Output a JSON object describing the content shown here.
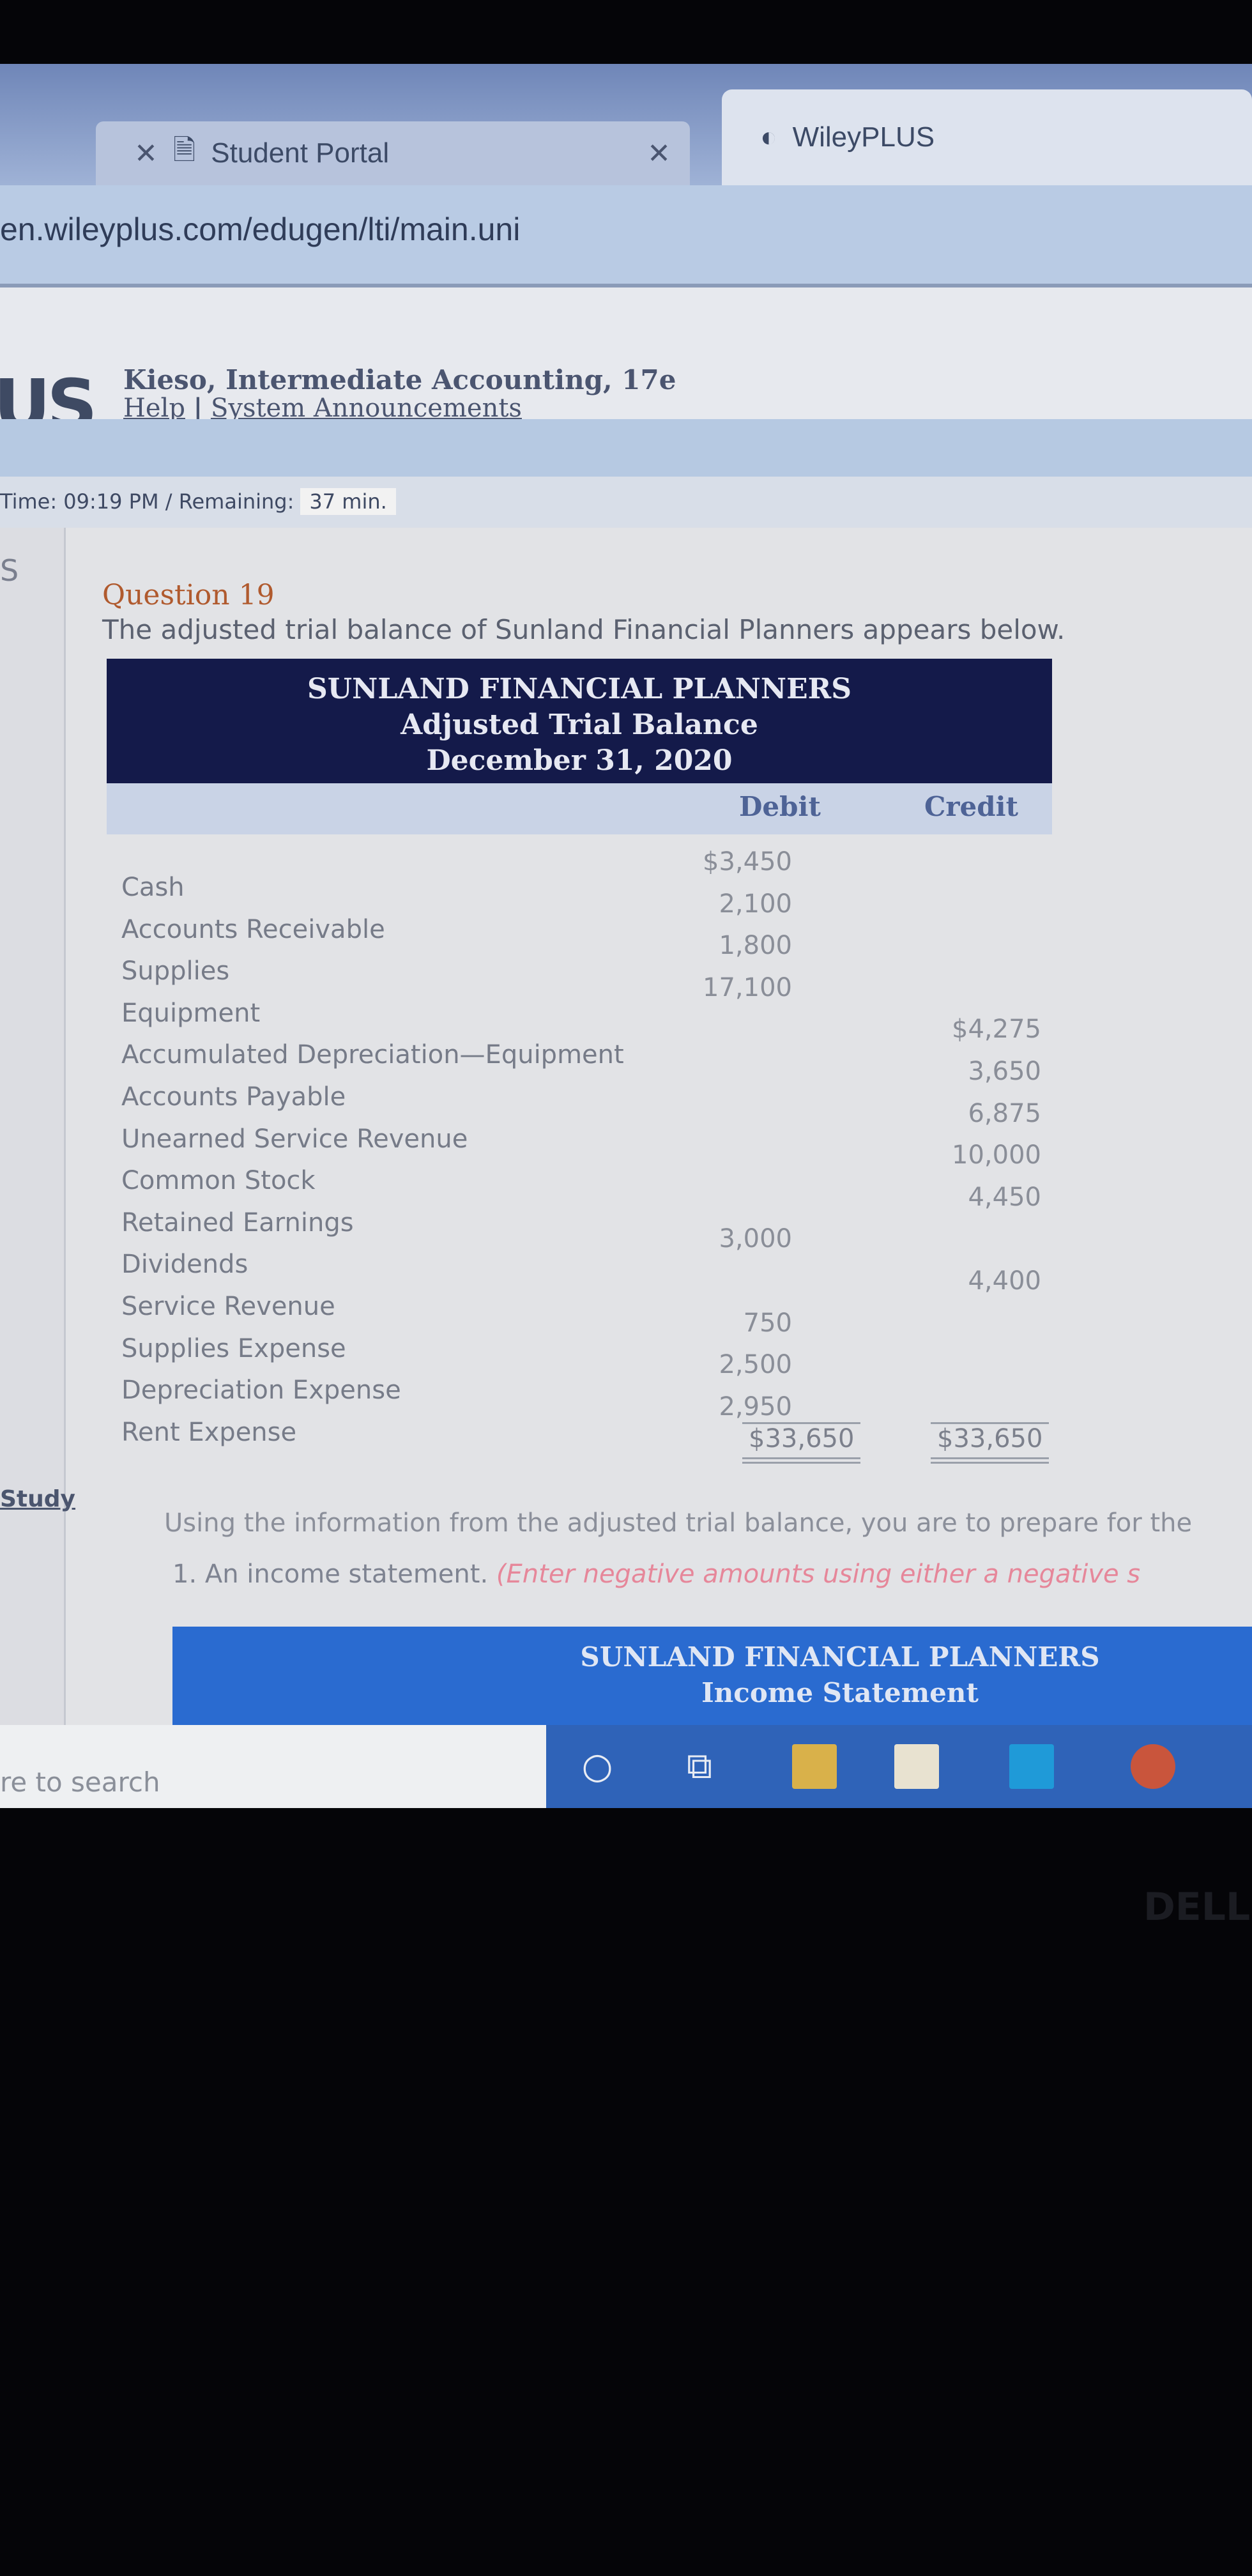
{
  "browser": {
    "tabs": [
      {
        "label": "Student Portal",
        "icon": "page-icon"
      },
      {
        "label": "WileyPLUS",
        "icon": "wileyplus-icon",
        "active": true
      }
    ],
    "url": "en.wileyplus.com/edugen/lti/main.uni"
  },
  "header": {
    "logo": "US",
    "course": "Kieso, Intermediate Accounting, 17e",
    "help": "Help",
    "separator": "|",
    "announcements": "System Announcements"
  },
  "timer": {
    "label": "Time: 09:19 PM / Remaining:",
    "remaining": "37 min."
  },
  "sidebar": {
    "top_letter": "S",
    "study": "Study"
  },
  "question": {
    "title": "Question 19",
    "intro": "The adjusted trial balance of Sunland Financial Planners appears below.",
    "table": {
      "company": "SUNLAND FINANCIAL PLANNERS",
      "name": "Adjusted Trial Balance",
      "date": "December 31, 2020",
      "debit_header": "Debit",
      "credit_header": "Credit",
      "rows": [
        {
          "account": "Cash",
          "debit": "$3,450",
          "credit": ""
        },
        {
          "account": "Accounts Receivable",
          "debit": "2,100",
          "credit": ""
        },
        {
          "account": "Supplies",
          "debit": "1,800",
          "credit": ""
        },
        {
          "account": "Equipment",
          "debit": "17,100",
          "credit": ""
        },
        {
          "account": "Accumulated Depreciation—Equipment",
          "debit": "",
          "credit": "$4,275"
        },
        {
          "account": "Accounts Payable",
          "debit": "",
          "credit": "3,650"
        },
        {
          "account": "Unearned Service Revenue",
          "debit": "",
          "credit": "6,875"
        },
        {
          "account": "Common Stock",
          "debit": "",
          "credit": "10,000"
        },
        {
          "account": "Retained Earnings",
          "debit": "",
          "credit": "4,450"
        },
        {
          "account": "Dividends",
          "debit": "3,000",
          "credit": ""
        },
        {
          "account": "Service Revenue",
          "debit": "",
          "credit": "4,400"
        },
        {
          "account": "Supplies Expense",
          "debit": "750",
          "credit": ""
        },
        {
          "account": "Depreciation Expense",
          "debit": "2,500",
          "credit": ""
        },
        {
          "account": "Rent Expense",
          "debit": "2,950",
          "credit": ""
        }
      ],
      "total_debit": "$33,650",
      "total_credit": "$33,650"
    },
    "instructions": "Using the information from the adjusted trial balance, you are to prepare for the",
    "item1": "1. An income statement.",
    "item1_note": "(Enter negative amounts using either a negative s",
    "income_statement": {
      "company": "SUNLAND FINANCIAL PLANNERS",
      "name": "Income Statement"
    }
  },
  "taskbar": {
    "search_placeholder": "re to search",
    "icons": [
      "cortana-icon",
      "task-view-icon",
      "file-explorer-icon",
      "store-icon",
      "mail-icon",
      "chrome-icon"
    ]
  },
  "bezel": {
    "brand": "DELL"
  }
}
